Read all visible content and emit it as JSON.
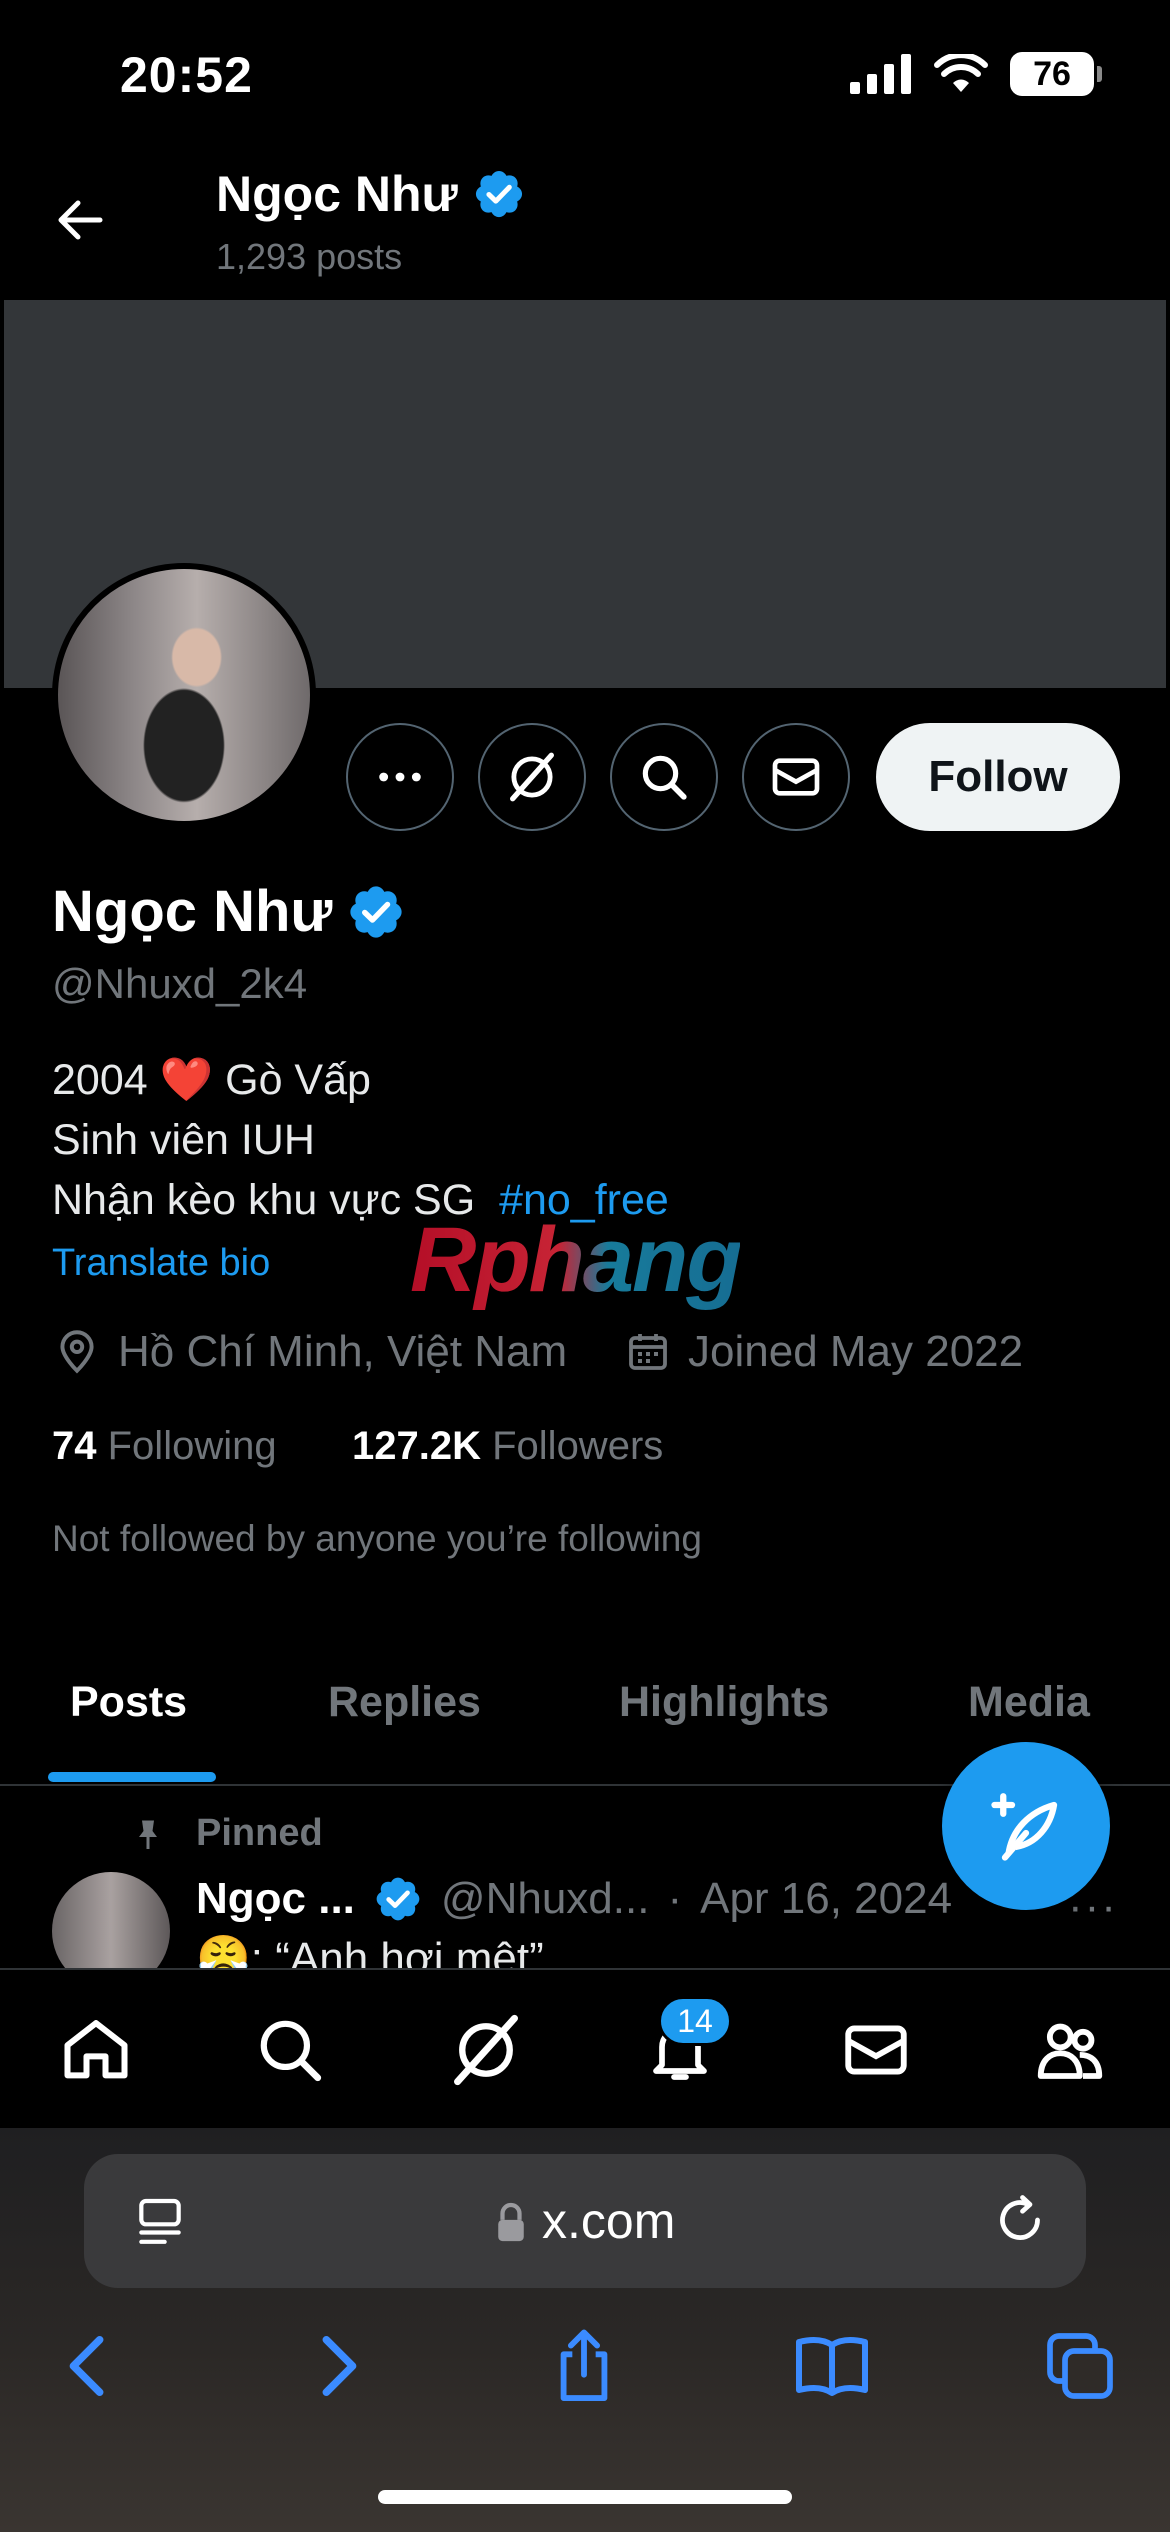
{
  "status_bar": {
    "time": "20:52",
    "battery": "76"
  },
  "header": {
    "name": "Ngọc Như",
    "posts_count": "1,293 posts"
  },
  "actions": {
    "follow_label": "Follow"
  },
  "profile": {
    "name": "Ngọc Như",
    "handle": "@Nhuxd_2k4",
    "bio_line1_a": "2004",
    "bio_line1_heart": "❤️",
    "bio_line1_b": "Gò Vấp",
    "bio_line2": "Sinh viên IUH",
    "bio_line3": "Nhận kèo khu vực SG",
    "bio_hashtag": "#no_free",
    "translate_label": "Translate bio",
    "location": "Hồ Chí Minh, Việt Nam",
    "joined": "Joined May 2022",
    "following_count": "74",
    "following_label": "Following",
    "followers_count": "127.2K",
    "followers_label": "Followers",
    "not_followed_text": "Not followed by anyone you’re following"
  },
  "watermark": "Rphang",
  "tabs": [
    {
      "label": "Posts"
    },
    {
      "label": "Replies"
    },
    {
      "label": "Highlights"
    },
    {
      "label": "Media"
    }
  ],
  "pinned_post": {
    "pinned_label": "Pinned",
    "author": "Ngọc ...",
    "handle": "@Nhuxd...",
    "separator": "·",
    "date": "Apr 16, 2024",
    "text": "😤: “Anh hơi mệt”",
    "more": "···"
  },
  "bottom_nav": {
    "notifications_badge": "14"
  },
  "browser": {
    "url": "x.com"
  },
  "colors": {
    "accent": "#1d9bf0",
    "background": "#000000",
    "muted": "#71767b",
    "banner": "#333639"
  }
}
